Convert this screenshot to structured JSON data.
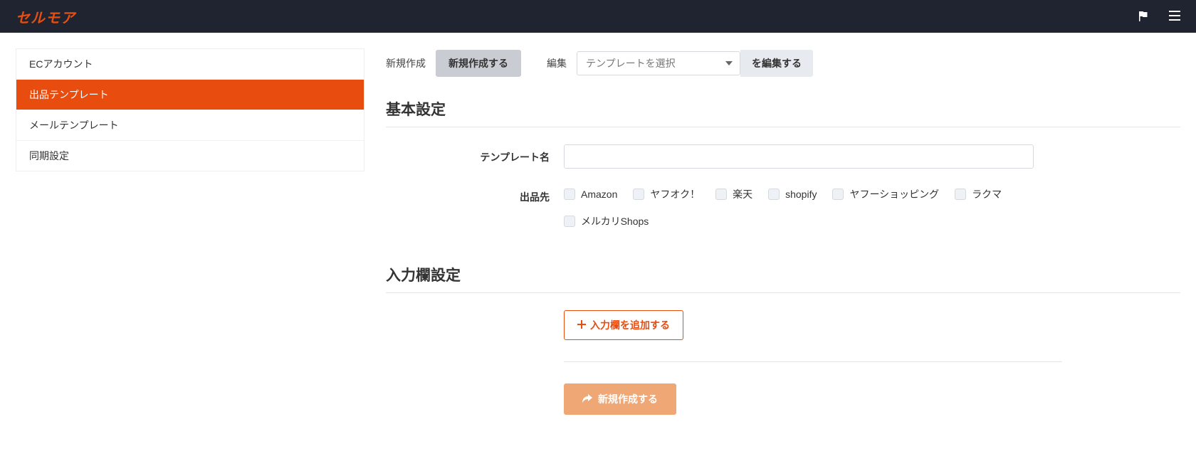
{
  "brand": "セルモア",
  "sidebar": {
    "items": [
      {
        "label": "ECアカウント",
        "active": false
      },
      {
        "label": "出品テンプレート",
        "active": true
      },
      {
        "label": "メールテンプレート",
        "active": false
      },
      {
        "label": "同期設定",
        "active": false
      }
    ]
  },
  "toolbar": {
    "create_label": "新規作成",
    "create_button": "新規作成する",
    "edit_label": "編集",
    "select_placeholder": "テンプレートを選択",
    "edit_button": "を編集する"
  },
  "sections": {
    "basic_title": "基本設定",
    "input_title": "入力欄設定"
  },
  "form": {
    "template_name_label": "テンプレート名",
    "template_name_value": "",
    "destination_label": "出品先",
    "destinations": [
      "Amazon",
      "ヤフオク！",
      "楽天",
      "shopify",
      "ヤフーショッピング",
      "ラクマ",
      "メルカリShops"
    ]
  },
  "buttons": {
    "add_input": "入力欄を追加する",
    "submit": "新規作成する"
  }
}
